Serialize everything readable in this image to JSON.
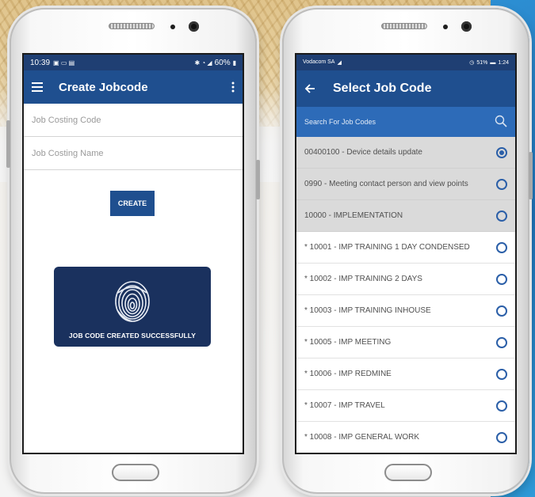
{
  "left_screen": {
    "status": {
      "time": "10:39",
      "battery": "60%"
    },
    "appbar": {
      "title": "Create Jobcode"
    },
    "fields": {
      "code_placeholder": "Job Costing Code",
      "name_placeholder": "Job Costing Name"
    },
    "create_label": "CREATE",
    "toast_message": "JOB CODE CREATED SUCCESSFULLY"
  },
  "right_screen": {
    "status": {
      "carrier": "Vodacom SA",
      "battery": "51%",
      "time": "1:24"
    },
    "appbar": {
      "title": "Select Job Code"
    },
    "search_placeholder": "Search For Job Codes",
    "items": [
      {
        "label": "00400100 - Device details update",
        "selected": true,
        "highlight": true
      },
      {
        "label": "0990 - Meeting contact person and view points",
        "selected": false,
        "highlight": true
      },
      {
        "label": "10000 - IMPLEMENTATION",
        "selected": false,
        "highlight": true
      },
      {
        "label": "* 10001 - IMP TRAINING 1 DAY CONDENSED",
        "selected": false,
        "highlight": false
      },
      {
        "label": "* 10002 - IMP TRAINING 2 DAYS",
        "selected": false,
        "highlight": false
      },
      {
        "label": "* 10003 - IMP TRAINING INHOUSE",
        "selected": false,
        "highlight": false
      },
      {
        "label": "* 10005 - IMP MEETING",
        "selected": false,
        "highlight": false
      },
      {
        "label": "* 10006 - IMP REDMINE",
        "selected": false,
        "highlight": false
      },
      {
        "label": "* 10007 - IMP TRAVEL",
        "selected": false,
        "highlight": false
      },
      {
        "label": "* 10008 - IMP GENERAL WORK",
        "selected": false,
        "highlight": false
      }
    ]
  },
  "colors": {
    "appbar": "#1f4f8f",
    "statusbar": "#1f3f73",
    "search": "#2d6bb8",
    "toast": "#1a315e",
    "radio": "#2b5fa8"
  },
  "icons": [
    "menu-icon",
    "more-vert-icon",
    "back-arrow-icon",
    "search-icon",
    "fingerprint-icon"
  ]
}
